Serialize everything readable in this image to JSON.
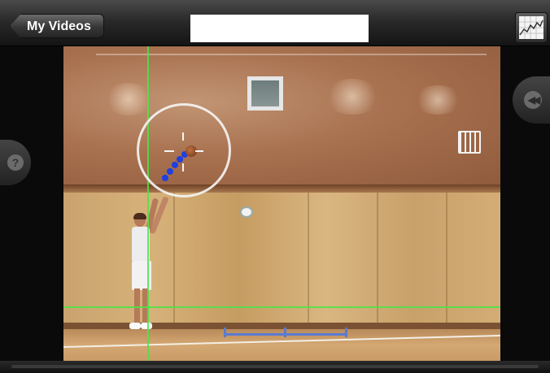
{
  "navbar": {
    "back_label": "My Videos",
    "title_text": ""
  },
  "video": {
    "guide_color": "#46e646",
    "trajectory_color": "#1f3fe0",
    "circle_color": "#f5f5f5"
  },
  "controls": {
    "graph_icon": "graph-chart-icon",
    "help_icon": "question-mark-icon",
    "rewind_icon": "rewind-icon",
    "help_glyph": "?",
    "rewind_glyph": "◀◀"
  }
}
